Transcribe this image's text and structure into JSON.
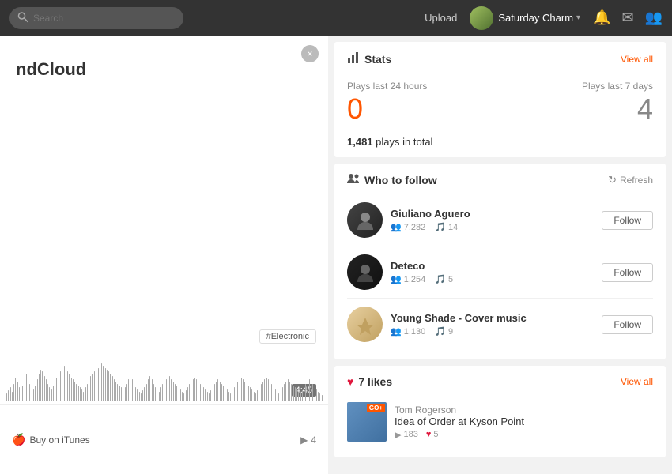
{
  "nav": {
    "search_placeholder": "Search",
    "upload_label": "Upload",
    "username": "Saturday Charm",
    "notification_icon": "🔔",
    "message_icon": "✉",
    "people_icon": "👥"
  },
  "left_panel": {
    "branding_text": "ndCloud",
    "close_icon": "×",
    "tag": "#Electronic",
    "time": "4:45",
    "itunes_label": "Buy on iTunes",
    "plays_count": "4"
  },
  "stats": {
    "title": "Stats",
    "view_all": "View all",
    "plays_24h_label": "Plays last 24 hours",
    "plays_24h_value": "0",
    "plays_7d_label": "Plays last 7 days",
    "plays_7d_value": "4",
    "total_label": "plays in total",
    "total_value": "1,481"
  },
  "who_to_follow": {
    "title": "Who to follow",
    "refresh_label": "Refresh",
    "items": [
      {
        "name": "Giuliano Aguero",
        "followers": "7,282",
        "tracks": "14",
        "follow_label": "Follow"
      },
      {
        "name": "Deteco",
        "followers": "1,254",
        "tracks": "5",
        "follow_label": "Follow"
      },
      {
        "name": "Young Shade - Cover music",
        "followers": "1,130",
        "tracks": "9",
        "follow_label": "Follow"
      }
    ]
  },
  "likes": {
    "title": "7 likes",
    "view_all": "View all",
    "items": [
      {
        "artist": "Tom Rogerson",
        "title": "Idea of Order at Kyson Point",
        "plays": "183",
        "likes": "5",
        "go_plus": "GO+"
      }
    ]
  }
}
